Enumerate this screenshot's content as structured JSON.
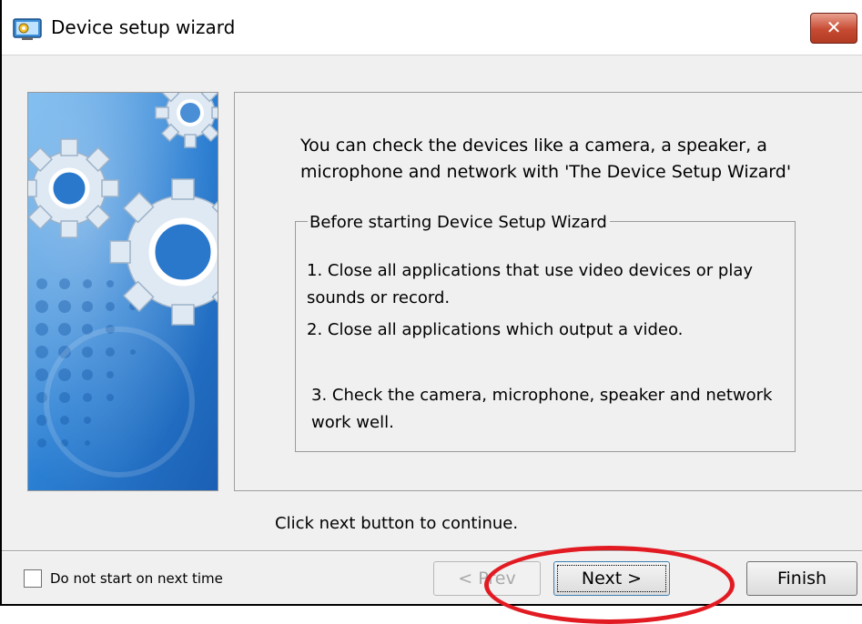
{
  "window": {
    "title": "Device setup wizard",
    "close_label": "✕",
    "icon": "device-setup-app-icon"
  },
  "content": {
    "intro": "You can check the devices like a camera, a speaker, a microphone and network with 'The Device Setup Wizard'",
    "group_title": "Before starting Device Setup Wizard",
    "steps": [
      "1. Close all applications that use video devices or play sounds or record.",
      "2. Close all applications which output a video.",
      "3. Check the camera, microphone, speaker and network work well."
    ]
  },
  "footer": {
    "hint": "Click next button to continue.",
    "checkbox_label": "Do not start on next time",
    "checkbox_checked": false,
    "prev_label": "< Prev",
    "next_label": "Next >",
    "finish_label": "Finish"
  },
  "colors": {
    "window_bg": "#f0f0f0",
    "close_button": "#c74b33",
    "banner_blue": "#1f73c9",
    "annotation_red": "#e21b23"
  }
}
